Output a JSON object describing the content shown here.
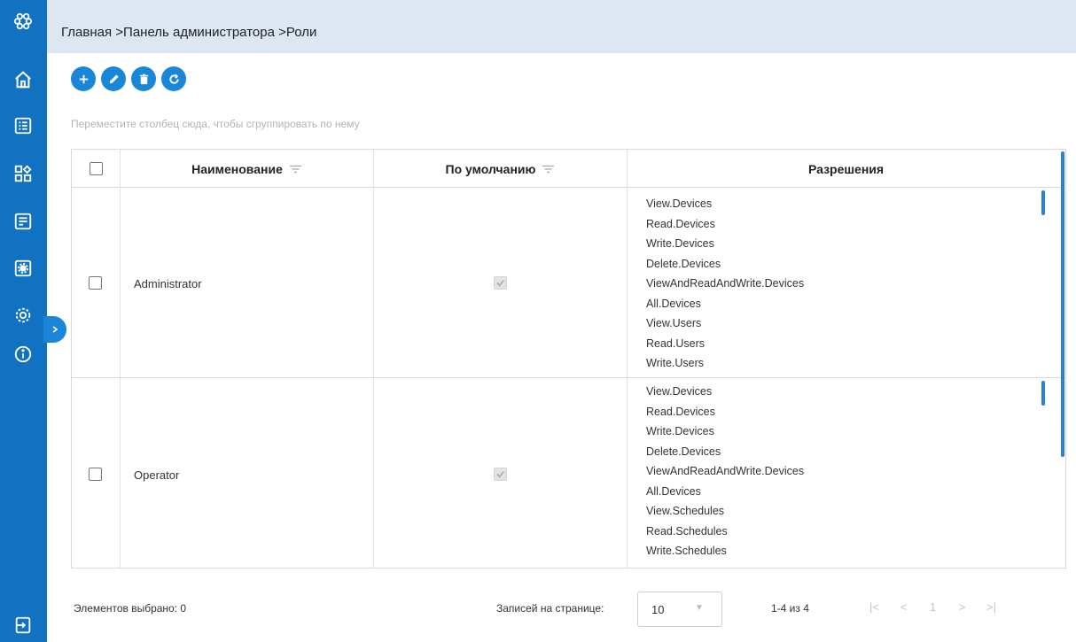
{
  "breadcrumb": {
    "home": "Главная",
    "sep1": " >",
    "admin": "Панель администратора",
    "sep2": " >",
    "current": "Роли"
  },
  "sidebar": {
    "icons": [
      "logo-icon",
      "home-icon",
      "list-icon",
      "dashboard-icon",
      "form-icon",
      "gear-square-icon",
      "settings-icon",
      "info-icon"
    ],
    "bottom_icon": "exit-icon"
  },
  "toolbar": {
    "buttons": [
      "add",
      "edit",
      "delete",
      "refresh"
    ]
  },
  "group_hint": "Переместите столбец сюда, чтобы сгруппировать по нему",
  "grid": {
    "columns": {
      "name": "Наименование",
      "default": "По умолчанию",
      "permissions": "Разрешения"
    },
    "rows": [
      {
        "name": "Administrator",
        "default_checked": true,
        "permissions": [
          "View.Devices",
          "Read.Devices",
          "Write.Devices",
          "Delete.Devices",
          "ViewAndReadAndWrite.Devices",
          "All.Devices",
          "View.Users",
          "Read.Users",
          "Write.Users"
        ]
      },
      {
        "name": "Operator",
        "default_checked": true,
        "permissions": [
          "View.Devices",
          "Read.Devices",
          "Write.Devices",
          "Delete.Devices",
          "ViewAndReadAndWrite.Devices",
          "All.Devices",
          "View.Schedules",
          "Read.Schedules",
          "Write.Schedules"
        ]
      }
    ]
  },
  "footer": {
    "selected": "Элементов выбрано: 0",
    "per_page_label": "Записей на странице:",
    "per_page_value": "10",
    "range": "1-4 из 4",
    "current_page": "1"
  },
  "colors": {
    "sidebar": "#1272c2",
    "accent": "#1a86d8",
    "topbar": "#dde7f2"
  }
}
